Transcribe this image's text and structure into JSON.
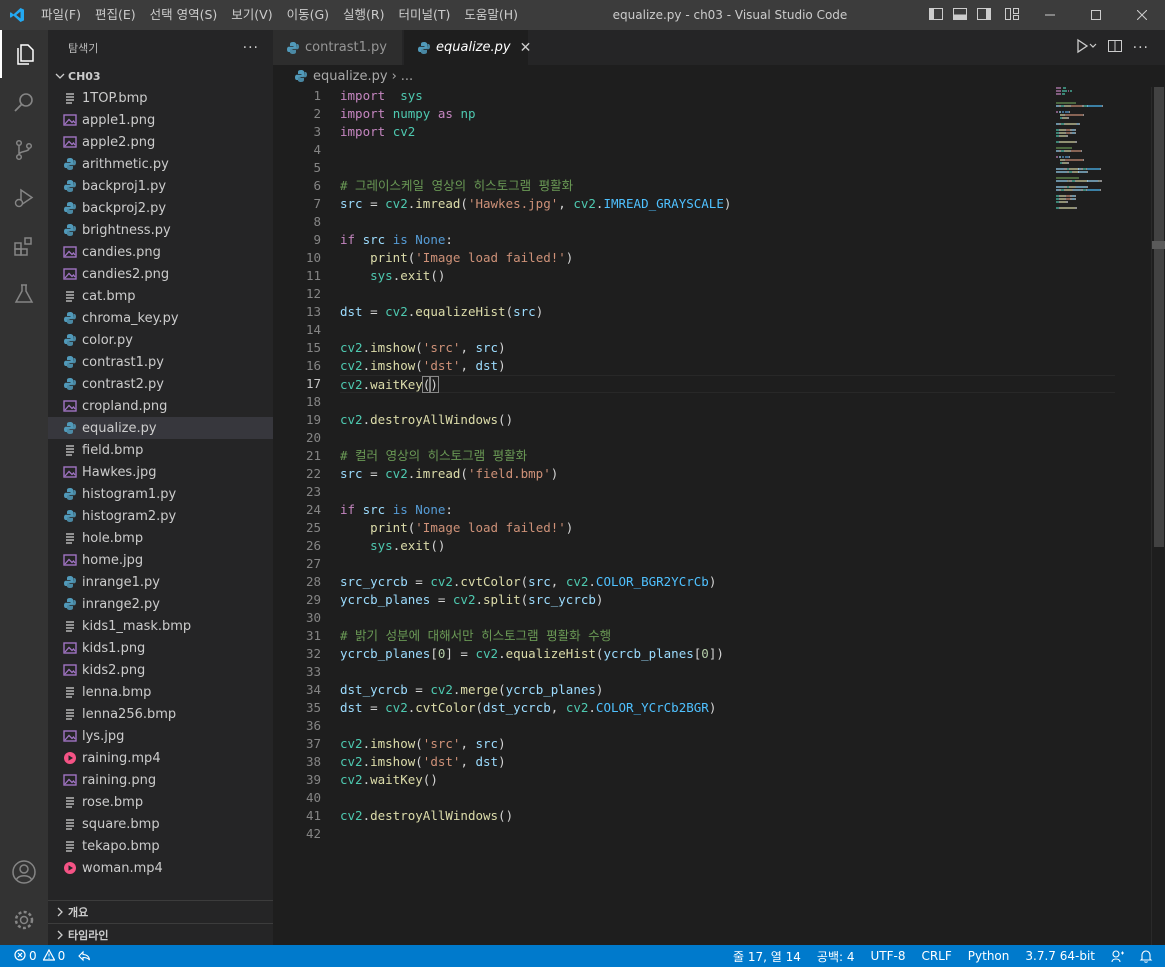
{
  "titlebar": {
    "menu": [
      "파일(F)",
      "편집(E)",
      "선택 영역(S)",
      "보기(V)",
      "이동(G)",
      "실행(R)",
      "터미널(T)",
      "도움말(H)"
    ],
    "title": "equalize.py - ch03 - Visual Studio Code"
  },
  "sidebar": {
    "header": "탐색기",
    "more": "···",
    "folder": "CH03",
    "files": [
      {
        "name": "1TOP.bmp",
        "type": "bmp"
      },
      {
        "name": "apple1.png",
        "type": "img"
      },
      {
        "name": "apple2.png",
        "type": "img"
      },
      {
        "name": "arithmetic.py",
        "type": "py"
      },
      {
        "name": "backproj1.py",
        "type": "py"
      },
      {
        "name": "backproj2.py",
        "type": "py"
      },
      {
        "name": "brightness.py",
        "type": "py"
      },
      {
        "name": "candies.png",
        "type": "img"
      },
      {
        "name": "candies2.png",
        "type": "img"
      },
      {
        "name": "cat.bmp",
        "type": "bmp"
      },
      {
        "name": "chroma_key.py",
        "type": "py"
      },
      {
        "name": "color.py",
        "type": "py"
      },
      {
        "name": "contrast1.py",
        "type": "py"
      },
      {
        "name": "contrast2.py",
        "type": "py"
      },
      {
        "name": "cropland.png",
        "type": "img"
      },
      {
        "name": "equalize.py",
        "type": "py",
        "active": true
      },
      {
        "name": "field.bmp",
        "type": "bmp"
      },
      {
        "name": "Hawkes.jpg",
        "type": "img"
      },
      {
        "name": "histogram1.py",
        "type": "py"
      },
      {
        "name": "histogram2.py",
        "type": "py"
      },
      {
        "name": "hole.bmp",
        "type": "bmp"
      },
      {
        "name": "home.jpg",
        "type": "img"
      },
      {
        "name": "inrange1.py",
        "type": "py"
      },
      {
        "name": "inrange2.py",
        "type": "py"
      },
      {
        "name": "kids1_mask.bmp",
        "type": "bmp"
      },
      {
        "name": "kids1.png",
        "type": "img"
      },
      {
        "name": "kids2.png",
        "type": "img"
      },
      {
        "name": "lenna.bmp",
        "type": "bmp"
      },
      {
        "name": "lenna256.bmp",
        "type": "bmp"
      },
      {
        "name": "lys.jpg",
        "type": "img"
      },
      {
        "name": "raining.mp4",
        "type": "mp4"
      },
      {
        "name": "raining.png",
        "type": "img"
      },
      {
        "name": "rose.bmp",
        "type": "bmp"
      },
      {
        "name": "square.bmp",
        "type": "bmp"
      },
      {
        "name": "tekapo.bmp",
        "type": "bmp"
      },
      {
        "name": "woman.mp4",
        "type": "mp4"
      }
    ],
    "outline": "개요",
    "timeline": "타임라인"
  },
  "tabs": [
    {
      "label": "contrast1.py",
      "active": false
    },
    {
      "label": "equalize.py",
      "active": true,
      "close": "✕"
    }
  ],
  "breadcrumb": {
    "file": "equalize.py",
    "more": "..."
  },
  "editor": {
    "current_line": 17,
    "lines": [
      [
        [
          "kw",
          "import"
        ],
        [
          "",
          "  "
        ],
        [
          "mod",
          "sys"
        ]
      ],
      [
        [
          "kw",
          "import"
        ],
        [
          "",
          " "
        ],
        [
          "mod",
          "numpy"
        ],
        [
          "",
          " "
        ],
        [
          "kw",
          "as"
        ],
        [
          "",
          " "
        ],
        [
          "mod",
          "np"
        ]
      ],
      [
        [
          "kw",
          "import"
        ],
        [
          "",
          " "
        ],
        [
          "mod",
          "cv2"
        ]
      ],
      [],
      [],
      [
        [
          "cm",
          "# 그레이스케일 영상의 히스토그램 평활화"
        ]
      ],
      [
        [
          "var",
          "src"
        ],
        [
          "",
          " = "
        ],
        [
          "mod",
          "cv2"
        ],
        [
          "",
          "."
        ],
        [
          "fn",
          "imread"
        ],
        [
          "",
          "("
        ],
        [
          "str",
          "'Hawkes.jpg'"
        ],
        [
          "",
          ", "
        ],
        [
          "mod",
          "cv2"
        ],
        [
          "",
          "."
        ],
        [
          "cst",
          "IMREAD_GRAYSCALE"
        ],
        [
          "",
          ")"
        ]
      ],
      [],
      [
        [
          "kw",
          "if"
        ],
        [
          "",
          " "
        ],
        [
          "var",
          "src"
        ],
        [
          "",
          " "
        ],
        [
          "bl",
          "is"
        ],
        [
          "",
          " "
        ],
        [
          "bl",
          "None"
        ],
        [
          "",
          ":"
        ]
      ],
      [
        [
          "",
          "    "
        ],
        [
          "fn",
          "print"
        ],
        [
          "",
          "("
        ],
        [
          "str",
          "'Image load failed!'"
        ],
        [
          "",
          ")"
        ]
      ],
      [
        [
          "",
          "    "
        ],
        [
          "mod",
          "sys"
        ],
        [
          "",
          "."
        ],
        [
          "fn",
          "exit"
        ],
        [
          "",
          "()"
        ]
      ],
      [],
      [
        [
          "var",
          "dst"
        ],
        [
          "",
          " = "
        ],
        [
          "mod",
          "cv2"
        ],
        [
          "",
          "."
        ],
        [
          "fn",
          "equalizeHist"
        ],
        [
          "",
          "("
        ],
        [
          "var",
          "src"
        ],
        [
          "",
          ")"
        ]
      ],
      [],
      [
        [
          "mod",
          "cv2"
        ],
        [
          "",
          "."
        ],
        [
          "fn",
          "imshow"
        ],
        [
          "",
          "("
        ],
        [
          "str",
          "'src'"
        ],
        [
          "",
          ", "
        ],
        [
          "var",
          "src"
        ],
        [
          "",
          ")"
        ]
      ],
      [
        [
          "mod",
          "cv2"
        ],
        [
          "",
          "."
        ],
        [
          "fn",
          "imshow"
        ],
        [
          "",
          "("
        ],
        [
          "str",
          "'dst'"
        ],
        [
          "",
          ", "
        ],
        [
          "var",
          "dst"
        ],
        [
          "",
          ")"
        ]
      ],
      [
        [
          "mod",
          "cv2"
        ],
        [
          "",
          "."
        ],
        [
          "fn",
          "waitKey"
        ],
        [
          "pb",
          "("
        ],
        [
          "pb",
          ")"
        ]
      ],
      [],
      [
        [
          "mod",
          "cv2"
        ],
        [
          "",
          "."
        ],
        [
          "fn",
          "destroyAllWindows"
        ],
        [
          "",
          "()"
        ]
      ],
      [],
      [
        [
          "cm",
          "# 컬러 영상의 히스토그램 평활화"
        ]
      ],
      [
        [
          "var",
          "src"
        ],
        [
          "",
          " = "
        ],
        [
          "mod",
          "cv2"
        ],
        [
          "",
          "."
        ],
        [
          "fn",
          "imread"
        ],
        [
          "",
          "("
        ],
        [
          "str",
          "'field.bmp'"
        ],
        [
          "",
          ")"
        ]
      ],
      [],
      [
        [
          "kw",
          "if"
        ],
        [
          "",
          " "
        ],
        [
          "var",
          "src"
        ],
        [
          "",
          " "
        ],
        [
          "bl",
          "is"
        ],
        [
          "",
          " "
        ],
        [
          "bl",
          "None"
        ],
        [
          "",
          ":"
        ]
      ],
      [
        [
          "",
          "    "
        ],
        [
          "fn",
          "print"
        ],
        [
          "",
          "("
        ],
        [
          "str",
          "'Image load failed!'"
        ],
        [
          "",
          ")"
        ]
      ],
      [
        [
          "",
          "    "
        ],
        [
          "mod",
          "sys"
        ],
        [
          "",
          "."
        ],
        [
          "fn",
          "exit"
        ],
        [
          "",
          "()"
        ]
      ],
      [],
      [
        [
          "var",
          "src_ycrcb"
        ],
        [
          "",
          " = "
        ],
        [
          "mod",
          "cv2"
        ],
        [
          "",
          "."
        ],
        [
          "fn",
          "cvtColor"
        ],
        [
          "",
          "("
        ],
        [
          "var",
          "src"
        ],
        [
          "",
          ", "
        ],
        [
          "mod",
          "cv2"
        ],
        [
          "",
          "."
        ],
        [
          "cst",
          "COLOR_BGR2YCrCb"
        ],
        [
          "",
          ")"
        ]
      ],
      [
        [
          "var",
          "ycrcb_planes"
        ],
        [
          "",
          " = "
        ],
        [
          "mod",
          "cv2"
        ],
        [
          "",
          "."
        ],
        [
          "fn",
          "split"
        ],
        [
          "",
          "("
        ],
        [
          "var",
          "src_ycrcb"
        ],
        [
          "",
          ")"
        ]
      ],
      [],
      [
        [
          "cm",
          "# 밝기 성분에 대해서만 히스토그램 평활화 수행"
        ]
      ],
      [
        [
          "var",
          "ycrcb_planes"
        ],
        [
          "",
          "["
        ],
        [
          "num",
          "0"
        ],
        [
          "",
          "] = "
        ],
        [
          "mod",
          "cv2"
        ],
        [
          "",
          "."
        ],
        [
          "fn",
          "equalizeHist"
        ],
        [
          "",
          "("
        ],
        [
          "var",
          "ycrcb_planes"
        ],
        [
          "",
          "["
        ],
        [
          "num",
          "0"
        ],
        [
          "",
          "])"
        ]
      ],
      [],
      [
        [
          "var",
          "dst_ycrcb"
        ],
        [
          "",
          " = "
        ],
        [
          "mod",
          "cv2"
        ],
        [
          "",
          "."
        ],
        [
          "fn",
          "merge"
        ],
        [
          "",
          "("
        ],
        [
          "var",
          "ycrcb_planes"
        ],
        [
          "",
          ")"
        ]
      ],
      [
        [
          "var",
          "dst"
        ],
        [
          "",
          " = "
        ],
        [
          "mod",
          "cv2"
        ],
        [
          "",
          "."
        ],
        [
          "fn",
          "cvtColor"
        ],
        [
          "",
          "("
        ],
        [
          "var",
          "dst_ycrcb"
        ],
        [
          "",
          ", "
        ],
        [
          "mod",
          "cv2"
        ],
        [
          "",
          "."
        ],
        [
          "cst",
          "COLOR_YCrCb2BGR"
        ],
        [
          "",
          ")"
        ]
      ],
      [],
      [
        [
          "mod",
          "cv2"
        ],
        [
          "",
          "."
        ],
        [
          "fn",
          "imshow"
        ],
        [
          "",
          "("
        ],
        [
          "str",
          "'src'"
        ],
        [
          "",
          ", "
        ],
        [
          "var",
          "src"
        ],
        [
          "",
          ")"
        ]
      ],
      [
        [
          "mod",
          "cv2"
        ],
        [
          "",
          "."
        ],
        [
          "fn",
          "imshow"
        ],
        [
          "",
          "("
        ],
        [
          "str",
          "'dst'"
        ],
        [
          "",
          ", "
        ],
        [
          "var",
          "dst"
        ],
        [
          "",
          ")"
        ]
      ],
      [
        [
          "mod",
          "cv2"
        ],
        [
          "",
          "."
        ],
        [
          "fn",
          "waitKey"
        ],
        [
          "",
          "()"
        ]
      ],
      [],
      [
        [
          "mod",
          "cv2"
        ],
        [
          "",
          "."
        ],
        [
          "fn",
          "destroyAllWindows"
        ],
        [
          "",
          "()"
        ]
      ],
      []
    ]
  },
  "statusbar": {
    "errors": "0",
    "warnings": "0",
    "position": "줄 17, 열 14",
    "spaces": "공백: 4",
    "encoding": "UTF-8",
    "eol": "CRLF",
    "language": "Python",
    "interpreter": "3.7.7 64-bit"
  },
  "colors": {
    "accent": "#007acc",
    "python_icon": "#519aba",
    "image_icon": "#a074c4",
    "video_icon": "#f55385"
  }
}
